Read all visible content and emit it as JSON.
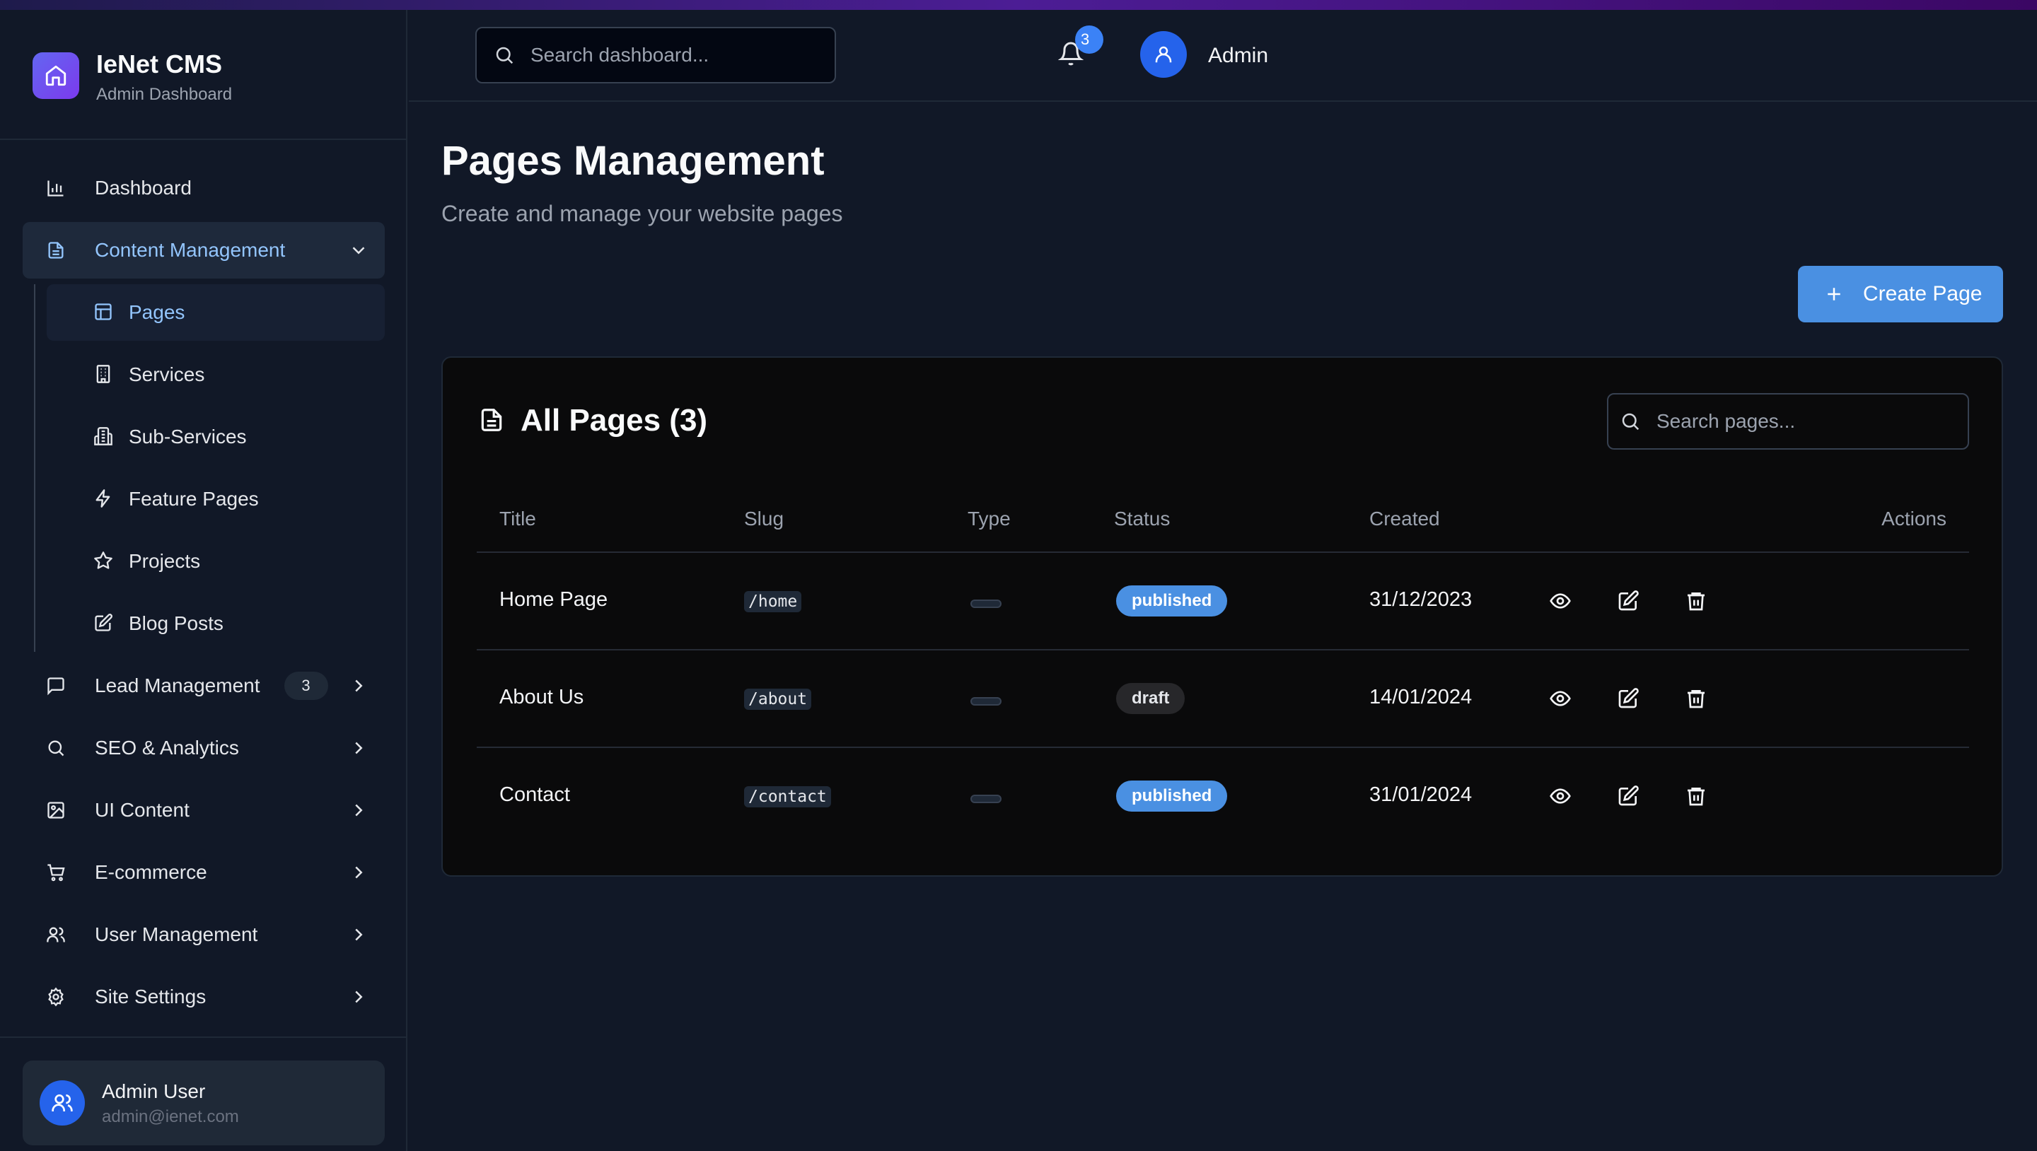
{
  "brand": {
    "title": "IeNet CMS",
    "subtitle": "Admin Dashboard"
  },
  "sidebar": {
    "items": [
      {
        "label": "Dashboard",
        "icon": "bar-chart-icon"
      },
      {
        "label": "Content Management",
        "icon": "document-icon",
        "expanded": true
      },
      {
        "label": "Lead Management",
        "icon": "message-icon",
        "badge": "3"
      },
      {
        "label": "SEO & Analytics",
        "icon": "search-icon"
      },
      {
        "label": "UI Content",
        "icon": "image-icon"
      },
      {
        "label": "E-commerce",
        "icon": "cart-icon"
      },
      {
        "label": "User Management",
        "icon": "users-icon"
      },
      {
        "label": "Site Settings",
        "icon": "gear-icon"
      }
    ],
    "content_sub": [
      {
        "label": "Pages",
        "icon": "layout-icon",
        "active": true
      },
      {
        "label": "Services",
        "icon": "building-icon"
      },
      {
        "label": "Sub-Services",
        "icon": "buildings-icon"
      },
      {
        "label": "Feature Pages",
        "icon": "bolt-icon"
      },
      {
        "label": "Projects",
        "icon": "star-icon"
      },
      {
        "label": "Blog Posts",
        "icon": "edit-icon"
      }
    ],
    "user": {
      "name": "Admin User",
      "email": "admin@ienet.com"
    }
  },
  "header": {
    "search_placeholder": "Search dashboard...",
    "notification_count": "3",
    "user_label": "Admin"
  },
  "main": {
    "title": "Pages Management",
    "subtitle": "Create and manage your website pages",
    "create_button": "Create Page",
    "card_title": "All Pages (3)",
    "search_placeholder": "Search pages...",
    "columns": [
      "Title",
      "Slug",
      "Type",
      "Status",
      "Created",
      "Actions"
    ],
    "rows": [
      {
        "title": "Home Page",
        "slug": "/home",
        "type": "",
        "status": "published",
        "created": "31/12/2023"
      },
      {
        "title": "About Us",
        "slug": "/about",
        "type": "",
        "status": "draft",
        "created": "14/01/2024"
      },
      {
        "title": "Contact",
        "slug": "/contact",
        "type": "",
        "status": "published",
        "created": "31/01/2024"
      }
    ]
  },
  "colors": {
    "accent": "#4a90e2",
    "background": "#111827",
    "card": "#0a0a0b",
    "active_text": "#93c5fd"
  }
}
